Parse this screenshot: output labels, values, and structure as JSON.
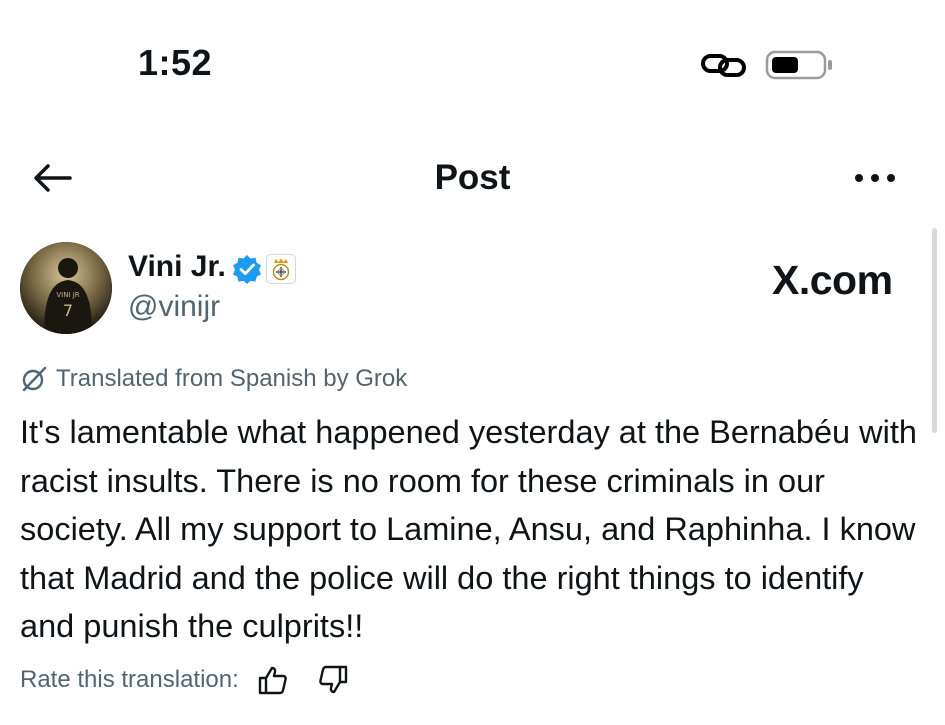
{
  "status_bar": {
    "time": "1:52",
    "link_icon": "link-icon",
    "battery_icon": "battery-icon"
  },
  "nav": {
    "back_icon": "back-arrow-icon",
    "title": "Post",
    "more_icon": "more-icon"
  },
  "post": {
    "author": {
      "display_name": "Vini Jr.",
      "handle": "@vinijr",
      "verified": true,
      "affiliation_badge": "real-madrid-crest-icon",
      "avatar_text": "VINI JR"
    },
    "watermark": "X.com",
    "translation_note": "Translated from Spanish by Grok",
    "text": "It's lamentable what happened yesterday at the Bernabéu with racist insults. There is no room for these criminals in our society. All my support to Lamine, Ansu, and Raphinha. I know that Madrid and the police will do the right things to identify and punish the culprits!!",
    "rate_label": "Rate this translation:"
  },
  "colors": {
    "text": "#0f1419",
    "secondary": "#536471",
    "verified": "#1d9bf0",
    "background": "#ffffff"
  }
}
